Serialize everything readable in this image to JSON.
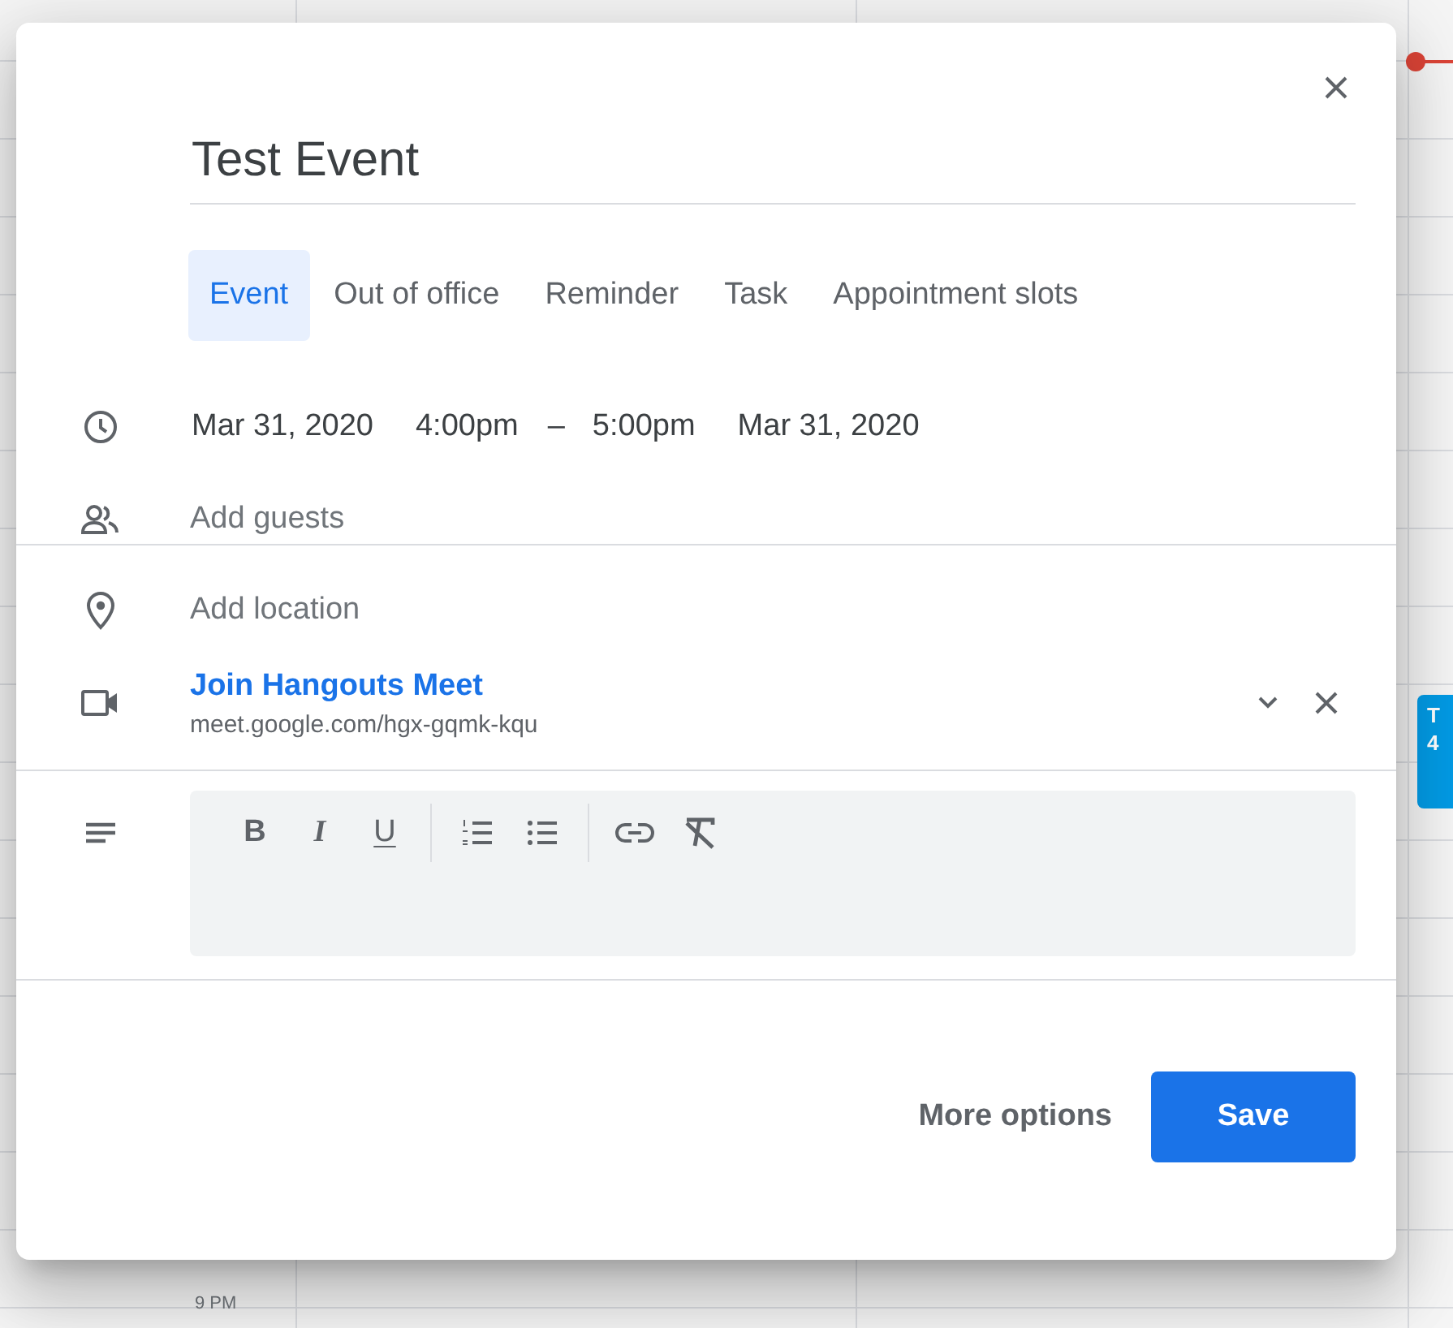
{
  "calendar": {
    "time_label": "9 PM",
    "event_chip": {
      "line_1": "T",
      "line_2": "4"
    }
  },
  "dialog": {
    "title": "Test Event",
    "tabs": [
      {
        "label": "Event",
        "selected": true
      },
      {
        "label": "Out of office",
        "selected": false
      },
      {
        "label": "Reminder",
        "selected": false
      },
      {
        "label": "Task",
        "selected": false
      },
      {
        "label": "Appointment slots",
        "selected": false
      }
    ],
    "date_time": {
      "start_date": "Mar 31, 2020",
      "start_time": "4:00pm",
      "separator": "–",
      "end_time": "5:00pm",
      "end_date": "Mar 31, 2020"
    },
    "guests": {
      "placeholder": "Add guests"
    },
    "location": {
      "placeholder": "Add location"
    },
    "conference": {
      "link": "Join Hangouts Meet",
      "url": "meet.google.com/hgx-gqmk-kqu"
    },
    "formatting_toolbar": [
      {
        "kind": "bold",
        "label": "B"
      },
      {
        "kind": "italic",
        "label": "I"
      },
      {
        "kind": "underline",
        "label": "U"
      },
      {
        "kind": "divider"
      },
      {
        "kind": "numbered-list"
      },
      {
        "kind": "bulleted-list"
      },
      {
        "kind": "divider"
      },
      {
        "kind": "link"
      },
      {
        "kind": "clear-format"
      }
    ],
    "actions": {
      "more_options": "More options",
      "save": "Save"
    }
  }
}
